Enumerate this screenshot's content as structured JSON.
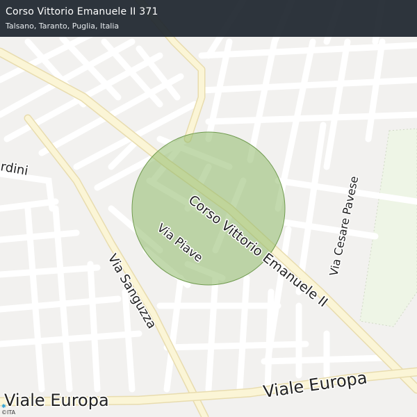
{
  "header": {
    "title": "Corso Vittorio Emanuele II 371",
    "subtitle": "Talsano, Taranto, Puglia, Italia"
  },
  "map": {
    "colors": {
      "background": "#f2f1ef",
      "block": "#e4e3e1",
      "minor_road": "#ffffff",
      "major_road": "#fbf5d6",
      "major_road_casing": "#e8dcae",
      "park": "#eef5e6",
      "circle_fill": "#8fba6a",
      "circle_stroke": "#6f9a4e"
    },
    "labels": {
      "corso": "Corso Vittorio Emanuele II",
      "piave": "Via Piave",
      "sanguzza": "Via Sanguzza",
      "cesare_pavese": "Via Cesare Pavese",
      "europa_center": "Viale Europa",
      "europa_left": "Viale Europa",
      "giardini_partial": "rdini"
    }
  },
  "attribution": {
    "text": "©ITA"
  }
}
